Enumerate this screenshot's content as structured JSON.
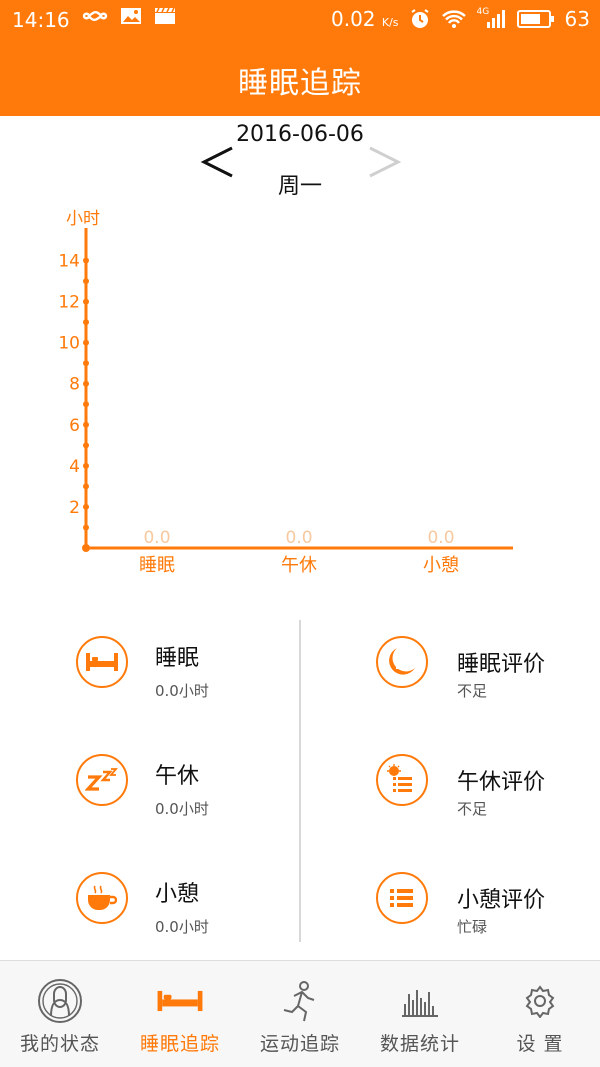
{
  "status_bar": {
    "time": "14:16",
    "net_speed": "0.02",
    "net_unit": "K/s",
    "network_type": "4G",
    "battery": "63",
    "icons": [
      "infinity-icon",
      "image-icon",
      "clapper-icon",
      "alarm-icon",
      "wifi-icon",
      "signal-icon",
      "battery-icon"
    ]
  },
  "header": {
    "title": "睡眠追踪"
  },
  "date_nav": {
    "date": "2016-06-06",
    "weekday": "周一"
  },
  "chart_data": {
    "type": "bar",
    "ylabel": "小时",
    "yticks": [
      "2",
      "4",
      "6",
      "8",
      "10",
      "12",
      "14"
    ],
    "ylim": [
      0,
      15
    ],
    "categories": [
      "睡眠",
      "午休",
      "小憩"
    ],
    "values": [
      0.0,
      0.0,
      0.0
    ],
    "value_labels": [
      "0.0",
      "0.0",
      "0.0"
    ],
    "accent_color": "#ff7a0a"
  },
  "summary": {
    "left": [
      {
        "title": "睡眠",
        "value": "0.0小时",
        "icon": "bed-icon"
      },
      {
        "title": "午休",
        "value": "0.0小时",
        "icon": "zzz-icon"
      },
      {
        "title": "小憩",
        "value": "0.0小时",
        "icon": "coffee-cup-icon"
      }
    ],
    "right": [
      {
        "title": "睡眠评价",
        "value": "不足",
        "icon": "moon-list-icon"
      },
      {
        "title": "午休评价",
        "value": "不足",
        "icon": "sun-list-icon"
      },
      {
        "title": "小憩评价",
        "value": "忙碌",
        "icon": "list-icon"
      }
    ]
  },
  "bottom_nav": {
    "tabs": [
      {
        "label": "我的状态",
        "icon": "profile-icon"
      },
      {
        "label": "睡眠追踪",
        "icon": "bed-icon",
        "active": true
      },
      {
        "label": "运动追踪",
        "icon": "runner-icon"
      },
      {
        "label": "数据统计",
        "icon": "stats-icon"
      },
      {
        "label": "设 置",
        "icon": "gear-icon"
      }
    ]
  },
  "colors": {
    "accent": "#ff7a0a",
    "grey_arrow": "#cfcfcf",
    "divider": "#d8d8d8"
  }
}
